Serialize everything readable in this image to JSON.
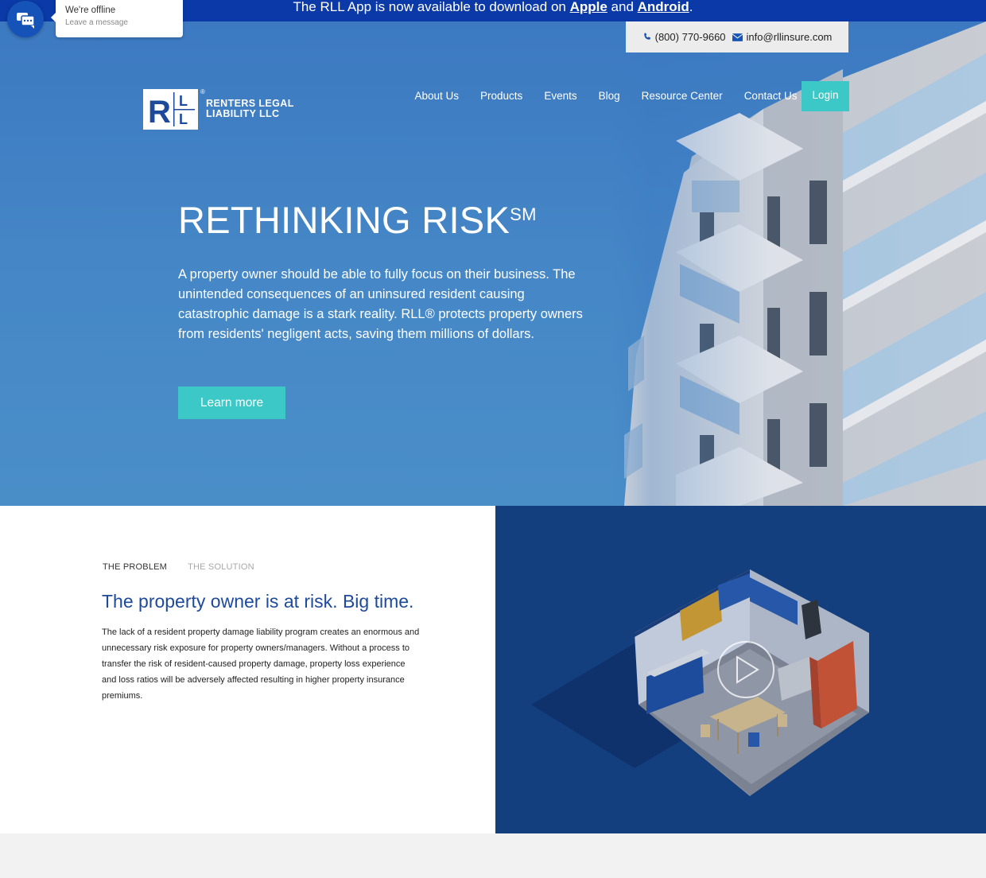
{
  "announcement": {
    "prefix": "The RLL App is now available to download on ",
    "apple": "Apple",
    "middle": " and ",
    "android": "Android",
    "suffix": "."
  },
  "contact": {
    "phone": "(800) 770-9660",
    "email": "info@rllinsure.com",
    "phone_icon": "phone-icon",
    "email_icon": "envelope-icon"
  },
  "logo": {
    "mark": "RLL",
    "line1": "RENTERS LEGAL",
    "line2": "LIABILITY LLC",
    "reg": "®"
  },
  "nav": {
    "items": [
      "About Us",
      "Products",
      "Events",
      "Blog",
      "Resource Center",
      "Contact Us"
    ],
    "login": "Login"
  },
  "hero": {
    "title": "RETHINKING RISK",
    "title_sup": "SM",
    "body": "A property owner should be able to fully focus on their business. The unintended consequences of an uninsured resident causing catastrophic damage is a stark reality. RLL® protects property owners from residents' negligent acts, saving them millions of dollars.",
    "cta": "Learn more"
  },
  "problem": {
    "tabs": [
      "THE PROBLEM",
      "THE SOLUTION"
    ],
    "active_tab": "THE PROBLEM",
    "title": "The property owner is at risk. Big time.",
    "body": "The lack of a resident property damage liability program creates an enormous and unnecessary risk exposure for property owners/managers. Without a process to transfer the risk of resident-caused property damage, property loss experience and loss ratios will be adversely affected resulting in higher property insurance premiums."
  },
  "video": {
    "play_icon": "play-icon"
  },
  "chat": {
    "status": "We're offline",
    "sub": "Leave a message",
    "icon": "chat-icon"
  },
  "colors": {
    "topbar": "#0b3aa8",
    "accent": "#3cc8c6",
    "title_blue": "#1d4a9a",
    "video_bg": "#143f7e"
  }
}
